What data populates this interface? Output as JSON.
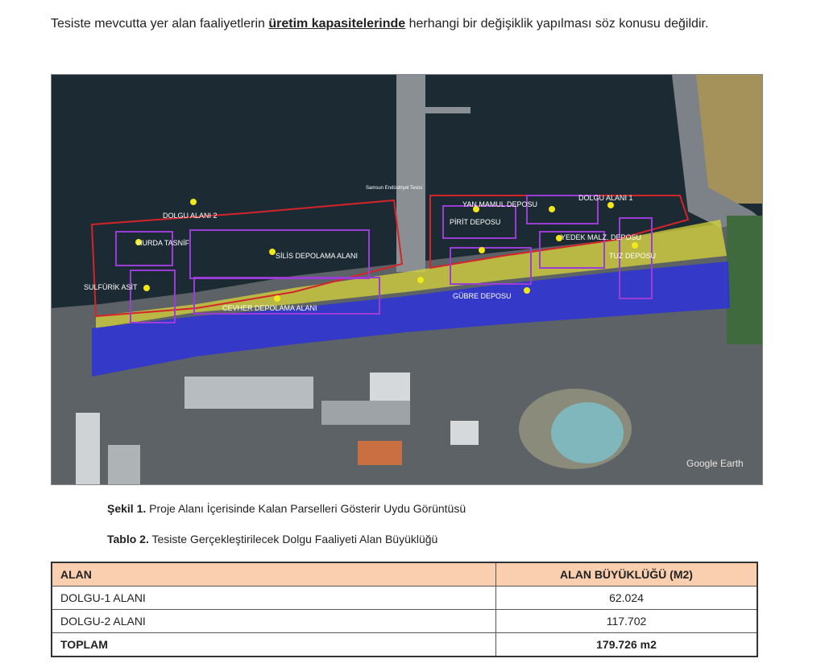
{
  "intro": {
    "part1": "Tesiste mevcutta yer alan faaliyetlerin ",
    "emphasis": "üretim kapasitelerinde",
    "part2": " herhangi bir değişiklik yapılması söz konusu değildir."
  },
  "figure": {
    "labels": {
      "dolgu2": "DOLGU ALANI 2",
      "hurda": "HURDA TASNİF",
      "silis": "SİLİS DEPOLAMA ALANI",
      "sulfurik": "SULFÜRİK ASİT",
      "yanmamul": "YAN MAMUL DEPOSU",
      "pirit": "PİRİT DEPOSU",
      "dolgu1": "DOLGU ALANI 1",
      "yedek": "YEDEK MALZ. DEPOSU",
      "gubre": "GÜBRE DEPOSU",
      "cevher": "CEVHER DEPOLAMA ALANI",
      "tuz": "TUZ DEPOSU",
      "tesis": "Samsun Endüstriyel Tesisi",
      "watermark": "Google Earth"
    },
    "colors": {
      "sea": "#1b2a33",
      "land": "#5d6266",
      "yellow_zone": "#d8d63a",
      "blue_zone": "#2b2fe0",
      "red_outline": "#d4242a",
      "purple_outline": "#9b3cd6"
    }
  },
  "captions": {
    "fig_prefix": "Şekil 1.",
    "fig_text": " Proje Alanı İçerisinde Kalan Parselleri Gösterir Uydu Görüntüsü",
    "tab_prefix": "Tablo 2.",
    "tab_text": " Tesiste Gerçekleştirilecek Dolgu Faaliyeti Alan Büyüklüğü"
  },
  "table": {
    "headers": [
      "ALAN",
      "ALAN BÜYÜKLÜĞÜ (M2)"
    ],
    "rows": [
      [
        "DOLGU-1 ALANI",
        "62.024"
      ],
      [
        "DOLGU-2 ALANI",
        "117.702"
      ]
    ],
    "total": [
      "TOPLAM",
      "179.726 m2"
    ]
  }
}
